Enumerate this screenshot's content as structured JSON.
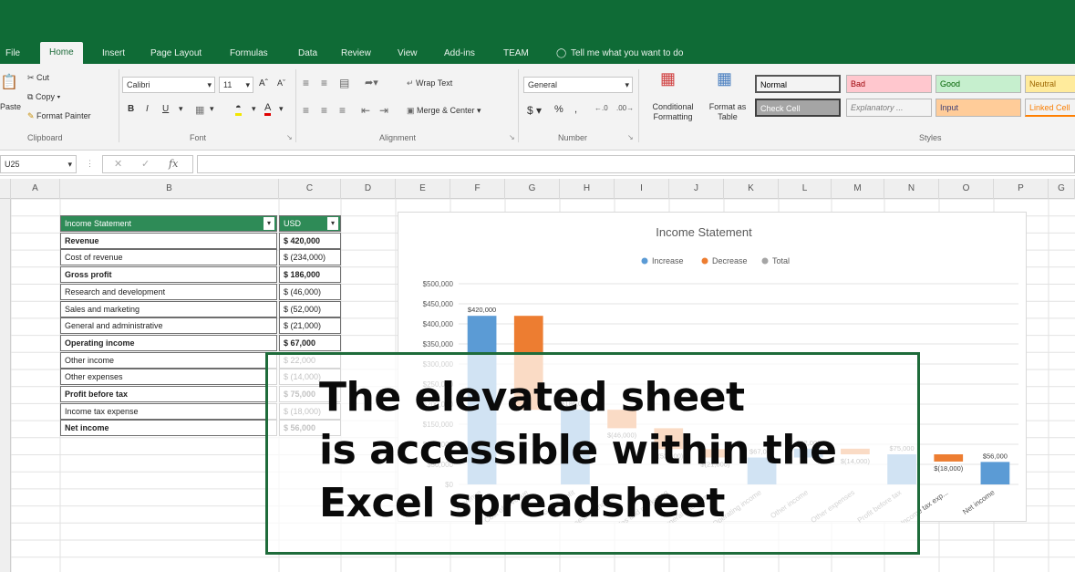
{
  "ribbon_tabs": [
    "File",
    "Home",
    "Insert",
    "Page Layout",
    "Formulas",
    "Data",
    "Review",
    "View",
    "Add-ins",
    "TEAM"
  ],
  "tell_me": "Tell me what you want to do",
  "clipboard": {
    "cut": "Cut",
    "copy": "Copy",
    "format_painter": "Format Painter",
    "label": "Clipboard",
    "paste": "Paste"
  },
  "font": {
    "name": "Calibri",
    "size": "11",
    "label": "Font"
  },
  "alignment": {
    "wrap": "Wrap Text",
    "merge": "Merge & Center",
    "label": "Alignment"
  },
  "number": {
    "format": "General",
    "label": "Number"
  },
  "styles": {
    "conditional": "Conditional Formatting",
    "format_table": "Format as Table",
    "label": "Styles",
    "cells": [
      {
        "text": "Normal",
        "bg": "#ffffff",
        "color": "#000000"
      },
      {
        "text": "Bad",
        "bg": "#ffc7ce",
        "color": "#9c0006"
      },
      {
        "text": "Good",
        "bg": "#c6efce",
        "color": "#006100"
      },
      {
        "text": "Neutral",
        "bg": "#ffeb9c",
        "color": "#9c6500"
      },
      {
        "text": "Check Cell",
        "bg": "#a5a5a5",
        "color": "#ffffff"
      },
      {
        "text": "Explanatory ...",
        "bg": "#ffffff",
        "color": "#7f7f7f"
      },
      {
        "text": "Input",
        "bg": "#ffcc99",
        "color": "#3f3f76"
      },
      {
        "text": "Linked Cell",
        "bg": "#ffffff",
        "color": "#fa7d00"
      }
    ]
  },
  "name_box": "U25",
  "columns": [
    "A",
    "B",
    "C",
    "D",
    "E",
    "F",
    "G",
    "H",
    "I",
    "J",
    "K",
    "L",
    "M",
    "N",
    "O",
    "P"
  ],
  "table": {
    "header": {
      "a": "Income Statement",
      "b": "USD"
    },
    "rows": [
      {
        "label": "Revenue",
        "value": "$ 420,000",
        "bold": true
      },
      {
        "label": "Cost of revenue",
        "value": "$ (234,000)",
        "bold": false
      },
      {
        "label": "Gross profit",
        "value": "$ 186,000",
        "bold": true
      },
      {
        "label": "Research and development",
        "value": "$ (46,000)",
        "bold": false
      },
      {
        "label": "Sales and marketing",
        "value": "$ (52,000)",
        "bold": false
      },
      {
        "label": "General and administrative",
        "value": "$ (21,000)",
        "bold": false
      },
      {
        "label": "Operating income",
        "value": "$ 67,000",
        "bold": true
      },
      {
        "label": "Other income",
        "value": "$ 22,000",
        "bold": false
      },
      {
        "label": "Other expenses",
        "value": "$ (14,000)",
        "bold": false
      },
      {
        "label": "Profit before tax",
        "value": "$ 75,000",
        "bold": true
      },
      {
        "label": "Income tax expense",
        "value": "$ (18,000)",
        "bold": false
      },
      {
        "label": "Net income",
        "value": "$ 56,000",
        "bold": true
      }
    ]
  },
  "chart_data": {
    "type": "bar",
    "title": "Income Statement",
    "legend": [
      "Increase",
      "Decrease",
      "Total"
    ],
    "colors": {
      "Increase": "#5b9bd5",
      "Decrease": "#ed7d31",
      "Total": "#a5a5a5"
    },
    "ylim": [
      0,
      500000
    ],
    "yticks": [
      "$0",
      "$50,000",
      "$100,000",
      "$150,000",
      "$200,000",
      "$250,000",
      "$300,000",
      "$350,000",
      "$400,000",
      "$450,000",
      "$500,000"
    ],
    "categories": [
      "Revenue",
      "Cost of revenue",
      "Gross profit",
      "Research and dev...",
      "Sales and marketing",
      "General and admi...",
      "Operating income",
      "Other income",
      "Other expenses",
      "Profit before tax",
      "Income tax exp...",
      "Net income"
    ],
    "bars": [
      {
        "start": 0,
        "end": 420000,
        "kind": "Increase",
        "label": "$420,000"
      },
      {
        "start": 420000,
        "end": 186000,
        "kind": "Decrease",
        "label": ""
      },
      {
        "start": 0,
        "end": 186000,
        "kind": "Increase",
        "label": "$186,000"
      },
      {
        "start": 186000,
        "end": 140000,
        "kind": "Decrease",
        "label": "$(46,000)"
      },
      {
        "start": 140000,
        "end": 88000,
        "kind": "Decrease",
        "label": "$(52,000)"
      },
      {
        "start": 88000,
        "end": 67000,
        "kind": "Decrease",
        "label": "$(21,000)"
      },
      {
        "start": 0,
        "end": 67000,
        "kind": "Increase",
        "label": "$67,000"
      },
      {
        "start": 67000,
        "end": 89000,
        "kind": "Increase",
        "label": "$22,000"
      },
      {
        "start": 89000,
        "end": 75000,
        "kind": "Decrease",
        "label": "$(14,000)"
      },
      {
        "start": 0,
        "end": 75000,
        "kind": "Increase",
        "label": "$75,000"
      },
      {
        "start": 75000,
        "end": 57000,
        "kind": "Decrease",
        "label": "$(18,000)"
      },
      {
        "start": 0,
        "end": 56000,
        "kind": "Increase",
        "label": "$56,000"
      }
    ]
  },
  "overlay": {
    "lines": [
      "The elevated sheet",
      "is accessible within the",
      "Excel spreadsheet"
    ]
  }
}
